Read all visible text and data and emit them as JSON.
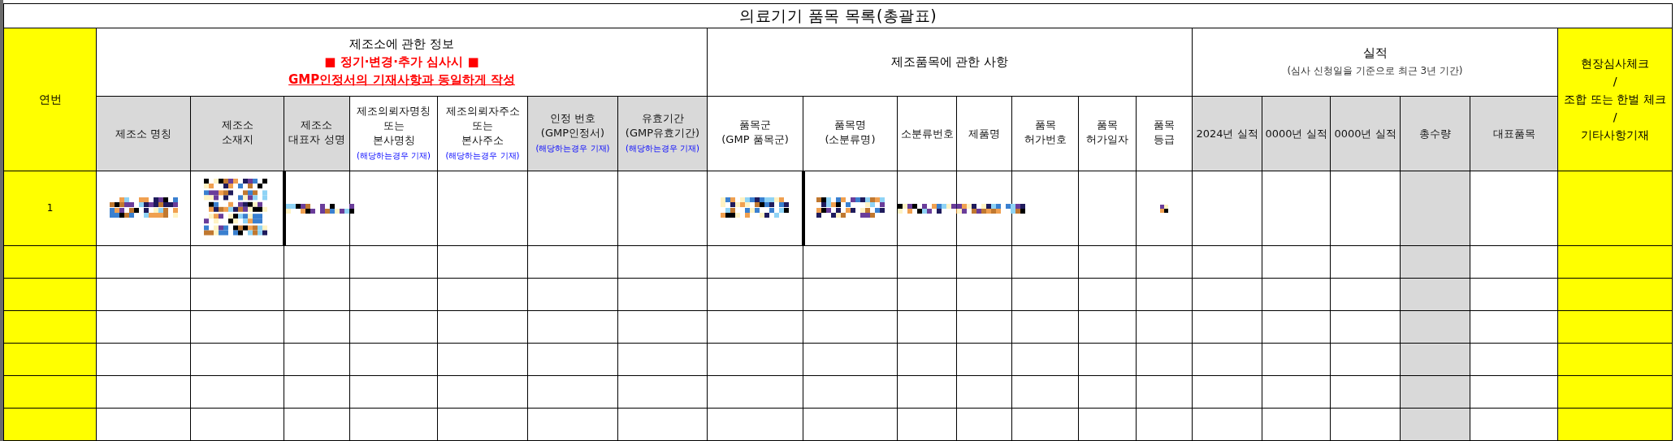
{
  "table": {
    "title": "의료기기  품목  목록(총괄표)",
    "index_header": "연번",
    "groups": [
      {
        "lines": [
          {
            "text": "제조소에  관한 정보",
            "kind": "plain"
          },
          {
            "text": "■ 정기·변경·추가 심사시 ■",
            "kind": "warning"
          },
          {
            "text": "GMP인정서의 기재사항과 동일하게 작성",
            "kind": "warning_underlined"
          }
        ],
        "columns": [
          {
            "lines": [
              "제조소 명칭"
            ],
            "shaded": true,
            "body_shaded": false
          },
          {
            "lines": [
              "제조소",
              "소재지"
            ],
            "shaded": true,
            "body_shaded": false
          },
          {
            "lines": [
              "제조소",
              "대표자 성명"
            ],
            "shaded": true,
            "body_shaded": false
          },
          {
            "lines": [
              "제조의뢰자명칭",
              "또는",
              "본사명칭"
            ],
            "note": "(해당하는경우 기재)",
            "shaded": false,
            "body_shaded": false
          },
          {
            "lines": [
              "제조의뢰자주소",
              "또는",
              "본사주소"
            ],
            "note": "(해당하는경우 기재)",
            "shaded": false,
            "body_shaded": false
          },
          {
            "lines": [
              "인정 번호",
              "(GMP인정서)"
            ],
            "note": "(해당하는경우 기재)",
            "shaded": true,
            "body_shaded": false
          },
          {
            "lines": [
              "유효기간",
              "(GMP유효기간)"
            ],
            "note": "(해당하는경우 기재)",
            "shaded": true,
            "body_shaded": false
          }
        ]
      },
      {
        "lines": [
          {
            "text": "제조품목에 관한 사항",
            "kind": "plain"
          }
        ],
        "columns": [
          {
            "lines": [
              "품목군",
              "(GMP 품목군)"
            ],
            "shaded": false,
            "body_shaded": false
          },
          {
            "lines": [
              "품목명",
              "(소분류명)"
            ],
            "shaded": false,
            "body_shaded": false
          },
          {
            "lines": [
              "소분류번호"
            ],
            "shaded": false,
            "body_shaded": false
          },
          {
            "lines": [
              "제품명"
            ],
            "shaded": false,
            "body_shaded": false
          },
          {
            "lines": [
              "품목",
              "허가번호"
            ],
            "shaded": false,
            "body_shaded": false
          },
          {
            "lines": [
              "품목",
              "허가일자"
            ],
            "shaded": false,
            "body_shaded": false
          },
          {
            "lines": [
              "품목",
              "등급"
            ],
            "shaded": false,
            "body_shaded": false
          }
        ]
      },
      {
        "lines": [
          {
            "text": "실적",
            "kind": "plain"
          },
          {
            "text": "(심사 신청일을 기준으로 최근 3년 기간)",
            "kind": "subtitle"
          }
        ],
        "columns": [
          {
            "lines": [
              "2024년 실적"
            ],
            "shaded": true,
            "body_shaded": false
          },
          {
            "lines": [
              "0000년 실적"
            ],
            "shaded": true,
            "body_shaded": false
          },
          {
            "lines": [
              "0000년 실적"
            ],
            "shaded": true,
            "body_shaded": false
          },
          {
            "lines": [
              "총수량"
            ],
            "shaded": true,
            "body_shaded": true
          },
          {
            "lines": [
              "대표품목"
            ],
            "shaded": true,
            "body_shaded": false
          }
        ]
      }
    ],
    "remarks_header": [
      "현장심사체크",
      "/",
      "조합 또는 한벌 체크",
      "/",
      "기타사항기재"
    ],
    "rows": [
      {
        "number": "1",
        "cells": [
          {
            "redacted": true,
            "bold_left": false
          },
          {
            "redacted": true,
            "bold_left": false
          },
          {
            "redacted": true,
            "bold_left": true
          },
          {
            "redacted": false,
            "bold_left": false
          },
          {
            "redacted": false,
            "bold_left": false
          },
          {
            "redacted": false,
            "bold_left": false
          },
          {
            "redacted": false,
            "bold_left": false
          },
          {
            "redacted": true,
            "bold_left": false
          },
          {
            "redacted": true,
            "bold_left": true
          },
          {
            "redacted": true,
            "bold_left": false
          },
          {
            "redacted": true,
            "bold_left": false
          },
          {
            "redacted": false,
            "bold_left": false
          },
          {
            "redacted": false,
            "bold_left": false
          },
          {
            "redacted": true,
            "bold_left": false
          },
          {
            "redacted": false,
            "bold_left": false
          },
          {
            "redacted": false,
            "bold_left": false
          },
          {
            "redacted": false,
            "bold_left": false
          },
          {
            "redacted": false,
            "bold_left": false
          },
          {
            "redacted": false,
            "bold_left": false
          }
        ]
      },
      {
        "cells": []
      },
      {
        "cells": []
      },
      {
        "cells": []
      },
      {
        "cells": []
      },
      {
        "cells": []
      },
      {
        "cells": []
      }
    ]
  }
}
